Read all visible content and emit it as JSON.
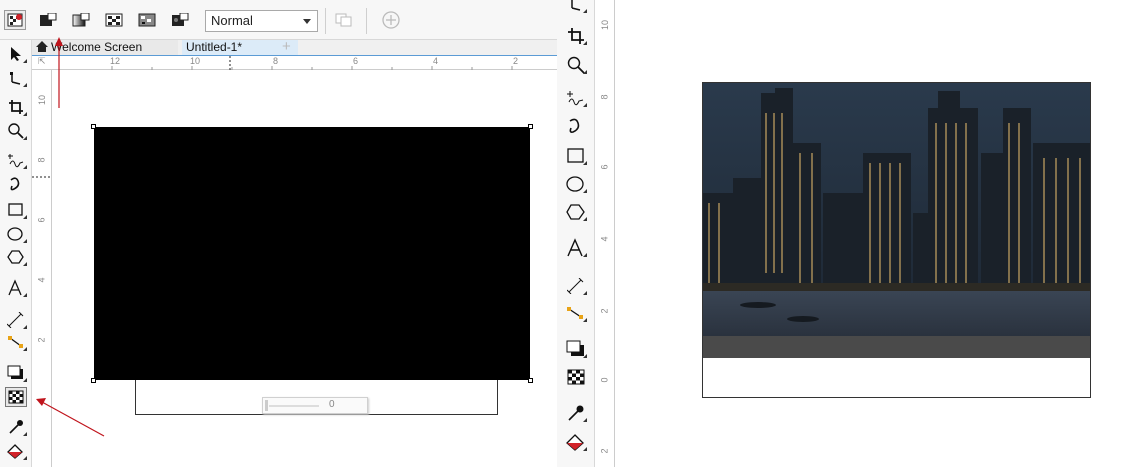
{
  "toolbar": {
    "merge_mode_value": "Normal"
  },
  "tabs": [
    {
      "label": "Welcome Screen",
      "icon": "home-icon"
    },
    {
      "label": "Untitled-1*"
    }
  ],
  "horizontal_ruler": {
    "labels": [
      "12",
      "10",
      "8",
      "6",
      "4",
      "2"
    ]
  },
  "vertical_ruler": {
    "labels": [
      "10",
      "8",
      "6",
      "4",
      "2"
    ]
  },
  "mid_ruler": {
    "labels": [
      "10",
      "8",
      "6",
      "4",
      "2",
      "0",
      "2"
    ]
  },
  "opacity_slider": {
    "value": "0"
  },
  "tools": [
    "pick-tool-icon",
    "shape-tool-icon",
    "crop-tool-icon",
    "zoom-tool-icon",
    "freehand-tool-icon",
    "artistic-media-icon",
    "rectangle-tool-icon",
    "ellipse-tool-icon",
    "polygon-tool-icon",
    "text-tool-icon",
    "parallel-dimension-icon",
    "connector-tool-icon",
    "drop-shadow-icon",
    "transparency-tool-icon",
    "eyedropper-icon",
    "interactive-fill-icon"
  ],
  "colors": {
    "accent_blue": "#5b9bd5",
    "annotation_red": "#c0141c",
    "canvas_black": "#000000",
    "photo_band": "#4a4a4a"
  }
}
